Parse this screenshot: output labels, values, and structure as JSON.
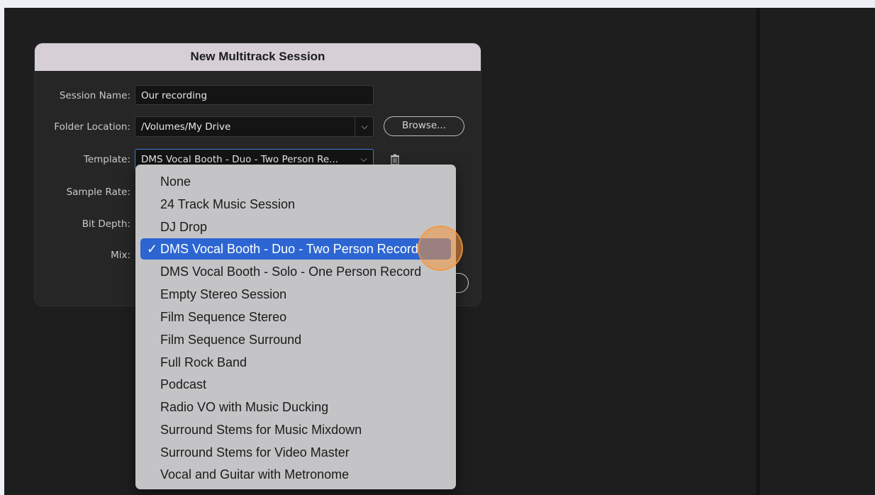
{
  "dialog": {
    "title": "New Multitrack Session",
    "session_name_label": "Session Name:",
    "session_name_value": "Our recording",
    "folder_location_label": "Folder Location:",
    "folder_location_value": "/Volumes/My Drive",
    "browse_label": "Browse...",
    "template_label": "Template:",
    "template_value": "DMS Vocal Booth - Duo - Two Person Re...",
    "sample_rate_label": "Sample Rate:",
    "bit_depth_label": "Bit Depth:",
    "mix_label": "Mix:"
  },
  "template_menu": {
    "selected_index": 3,
    "items": [
      "None",
      "24 Track Music Session",
      "DJ Drop",
      "DMS Vocal Booth - Duo - Two Person Record",
      "DMS Vocal Booth - Solo - One Person Record",
      "Empty Stereo Session",
      "Film Sequence Stereo",
      "Film Sequence Surround",
      "Full Rock Band",
      "Podcast",
      "Radio VO with Music Ducking",
      "Surround Stems for Music Mixdown",
      "Surround Stems for Video Master",
      "Vocal and Guitar with Metronome"
    ],
    "check_glyph": "✓"
  },
  "icons": {
    "dropdown": "chevron-down-icon",
    "delete_template": "trash-icon",
    "checkmark": "checkmark-icon"
  },
  "colors": {
    "menu_background": "#c4c4c6",
    "selection": "#2d66d3",
    "click_indicator": "#f5963c",
    "title_bar": "#d6d0d6"
  }
}
